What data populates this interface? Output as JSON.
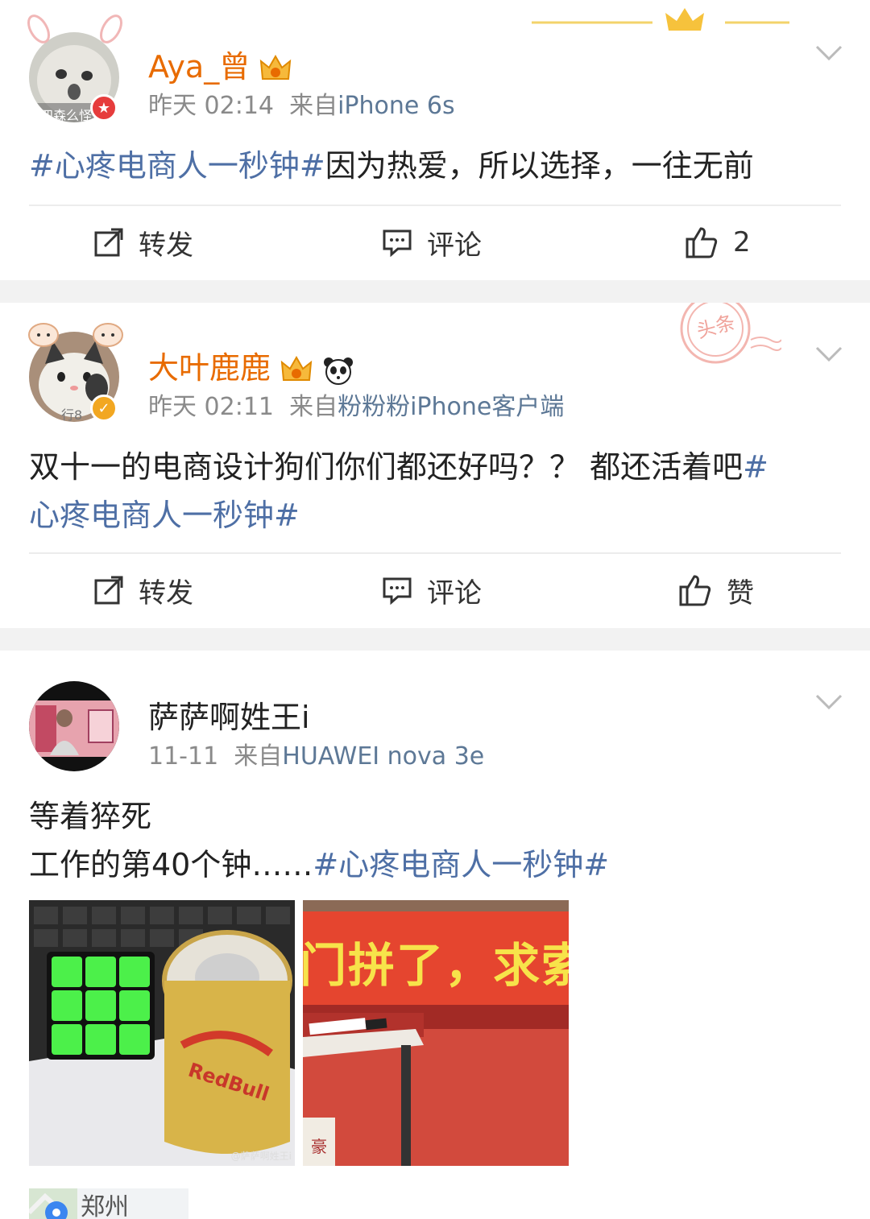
{
  "posts": [
    {
      "username": "Aya_曾",
      "time": "昨天 02:14",
      "from_prefix": "来自",
      "source": "iPhone 6s",
      "avatar_caption": "四森么怪",
      "content": {
        "tag": "#心疼电商人一秒钟#",
        "text": "因为热爱，所以选择，一往无前"
      },
      "actions": {
        "repost": "转发",
        "comment": "评论",
        "like": "2"
      }
    },
    {
      "username": "大叶鹿鹿",
      "time": "昨天 02:11",
      "from_prefix": "来自",
      "source": "粉粉粉iPhone客户端",
      "avatar_caption": "行8",
      "stamp": "头条",
      "content": {
        "line1_text": "双十一的电商设计狗们你们都还好吗？？ 都还活着吧",
        "line1_tag": "#",
        "line2_tag": "心疼电商人一秒钟#"
      },
      "actions": {
        "repost": "转发",
        "comment": "评论",
        "like": "赞"
      }
    },
    {
      "username": "萨萨啊姓王i",
      "time": "11-11",
      "from_prefix": "来自",
      "source": "HUAWEI nova 3e",
      "content": {
        "line1": "等着猝死",
        "line2_text": "工作的第40个钟……",
        "line2_tag": "#心疼电商人一秒钟#"
      },
      "images": [
        {
          "icon": "rubiks-cube-redbull-photo",
          "can_text": "RedBull",
          "watermark": "@萨萨啊姓王i"
        },
        {
          "icon": "banner-photo",
          "banner_text": "门拼了，求索",
          "card_text": "豪"
        }
      ],
      "location": "郑州"
    }
  ],
  "colors": {
    "accent_orange": "#e86b00",
    "link_blue": "#4e6fa5",
    "source_blue": "#5d7896",
    "meta_gray": "#8a8a8a",
    "divider": "#ececec",
    "background": "#f2f2f2"
  }
}
